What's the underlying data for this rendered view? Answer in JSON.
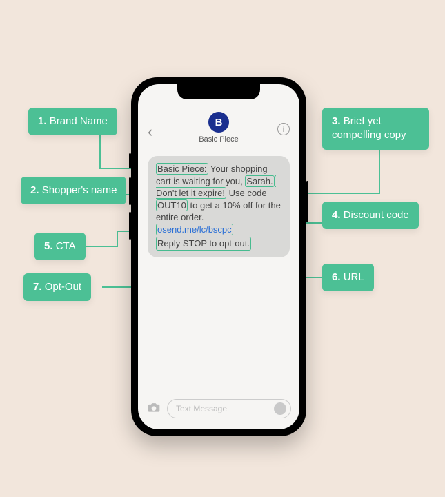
{
  "phone": {
    "contact_initial": "B",
    "contact_name": "Basic Piece",
    "message": {
      "brand": "Basic Piece:",
      "part1": " Your shopping cart is waiting for you, ",
      "shopper": "Sarah.",
      "copy": " Don't let it expire!",
      "part2": " Use code ",
      "code": "OUT10",
      "part3": " to get a 10% off for the entire order. ",
      "url": "osend.me/lc/bscpc",
      "optout": "Reply STOP to opt-out."
    },
    "input_placeholder": "Text Message"
  },
  "callouts": {
    "c1": {
      "num": "1.",
      "text": "Brand Name"
    },
    "c2": {
      "num": "2.",
      "text": "Shopper's name"
    },
    "c3": {
      "num": "3.",
      "text": "Brief yet compelling copy"
    },
    "c4": {
      "num": "4.",
      "text": "Discount code"
    },
    "c5": {
      "num": "5.",
      "text": "CTA"
    },
    "c6": {
      "num": "6.",
      "text": "URL"
    },
    "c7": {
      "num": "7.",
      "text": "Opt-Out"
    }
  }
}
